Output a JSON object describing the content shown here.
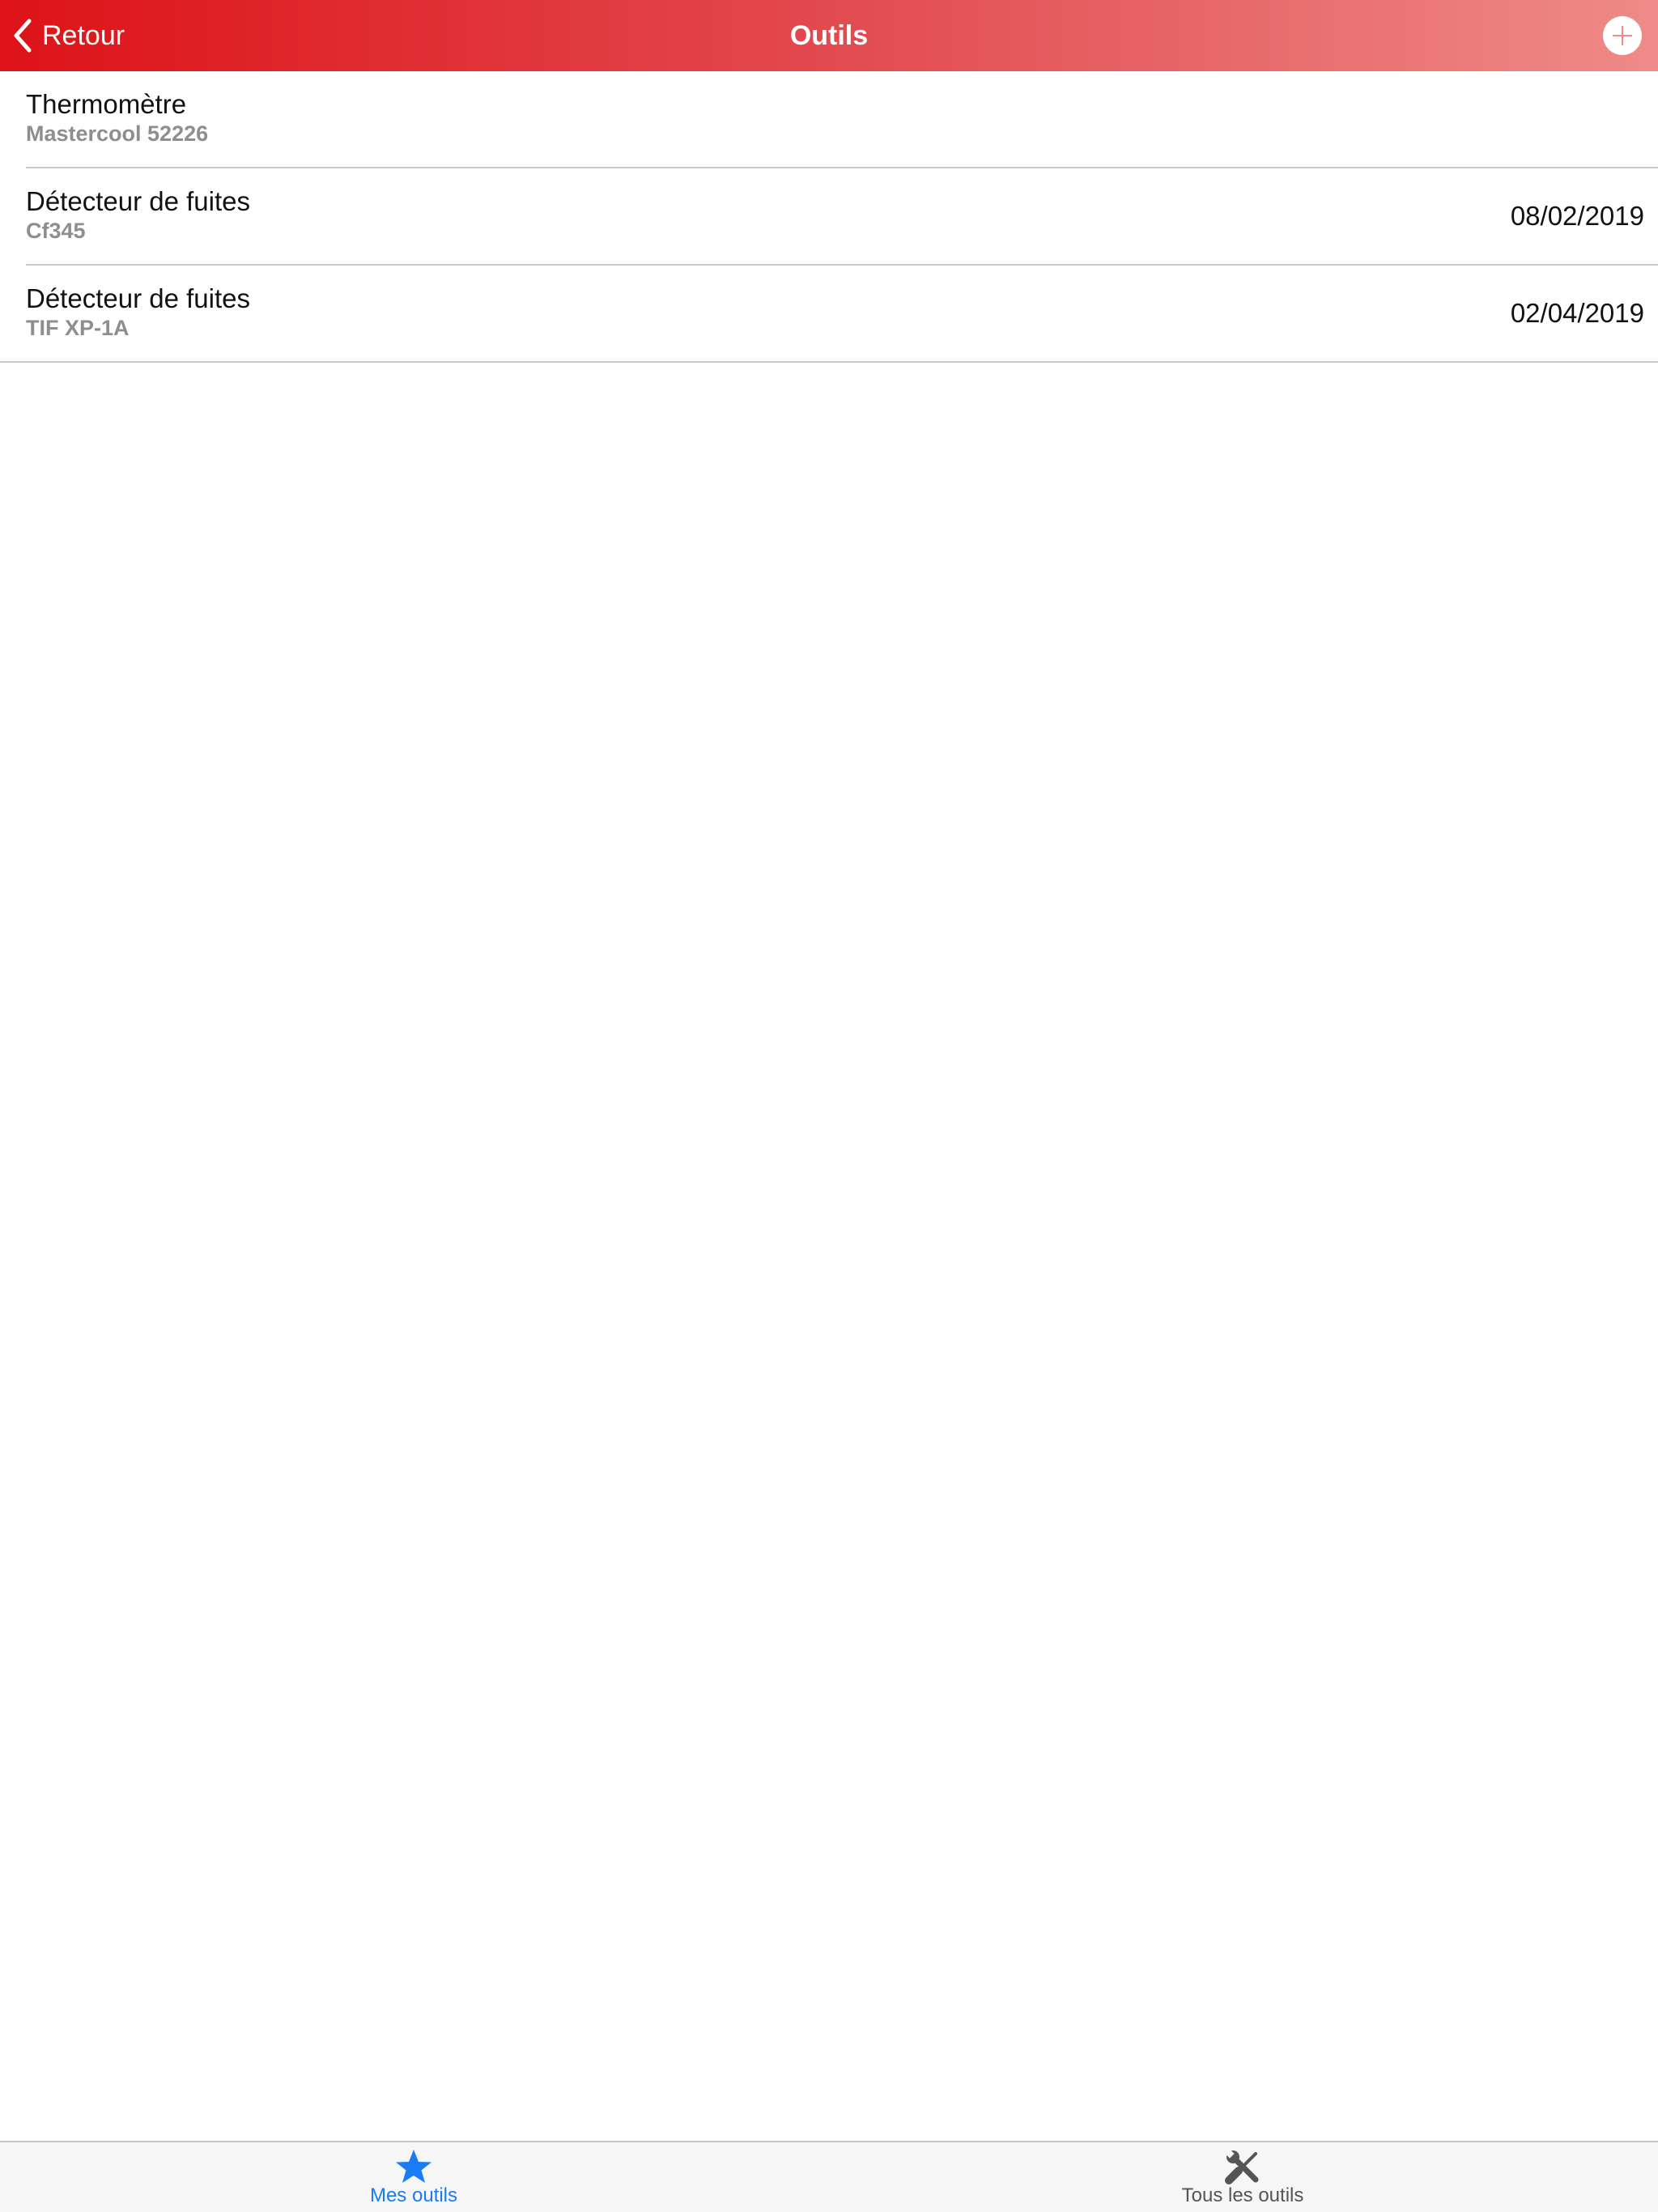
{
  "nav": {
    "back_label": "Retour",
    "title": "Outils",
    "add_icon": "plus-circle-icon"
  },
  "tools": [
    {
      "name": "Thermomètre",
      "model": "Mastercool 52226",
      "date": ""
    },
    {
      "name": "Détecteur de fuites",
      "model": "Cf345",
      "date": "08/02/2019"
    },
    {
      "name": "Détecteur de fuites",
      "model": "TIF XP-1A",
      "date": "02/04/2019"
    }
  ],
  "tabs": [
    {
      "label": "Mes outils",
      "icon": "star-icon",
      "selected": true
    },
    {
      "label": "Tous les outils",
      "icon": "tools-icon",
      "selected": false
    }
  ],
  "colors": {
    "nav_gradient_start": "#dd1318",
    "nav_gradient_end": "#ee8b88",
    "tab_active": "#1a7cf4",
    "tab_inactive": "#555555",
    "subtitle_gray": "#8e8e8e"
  }
}
